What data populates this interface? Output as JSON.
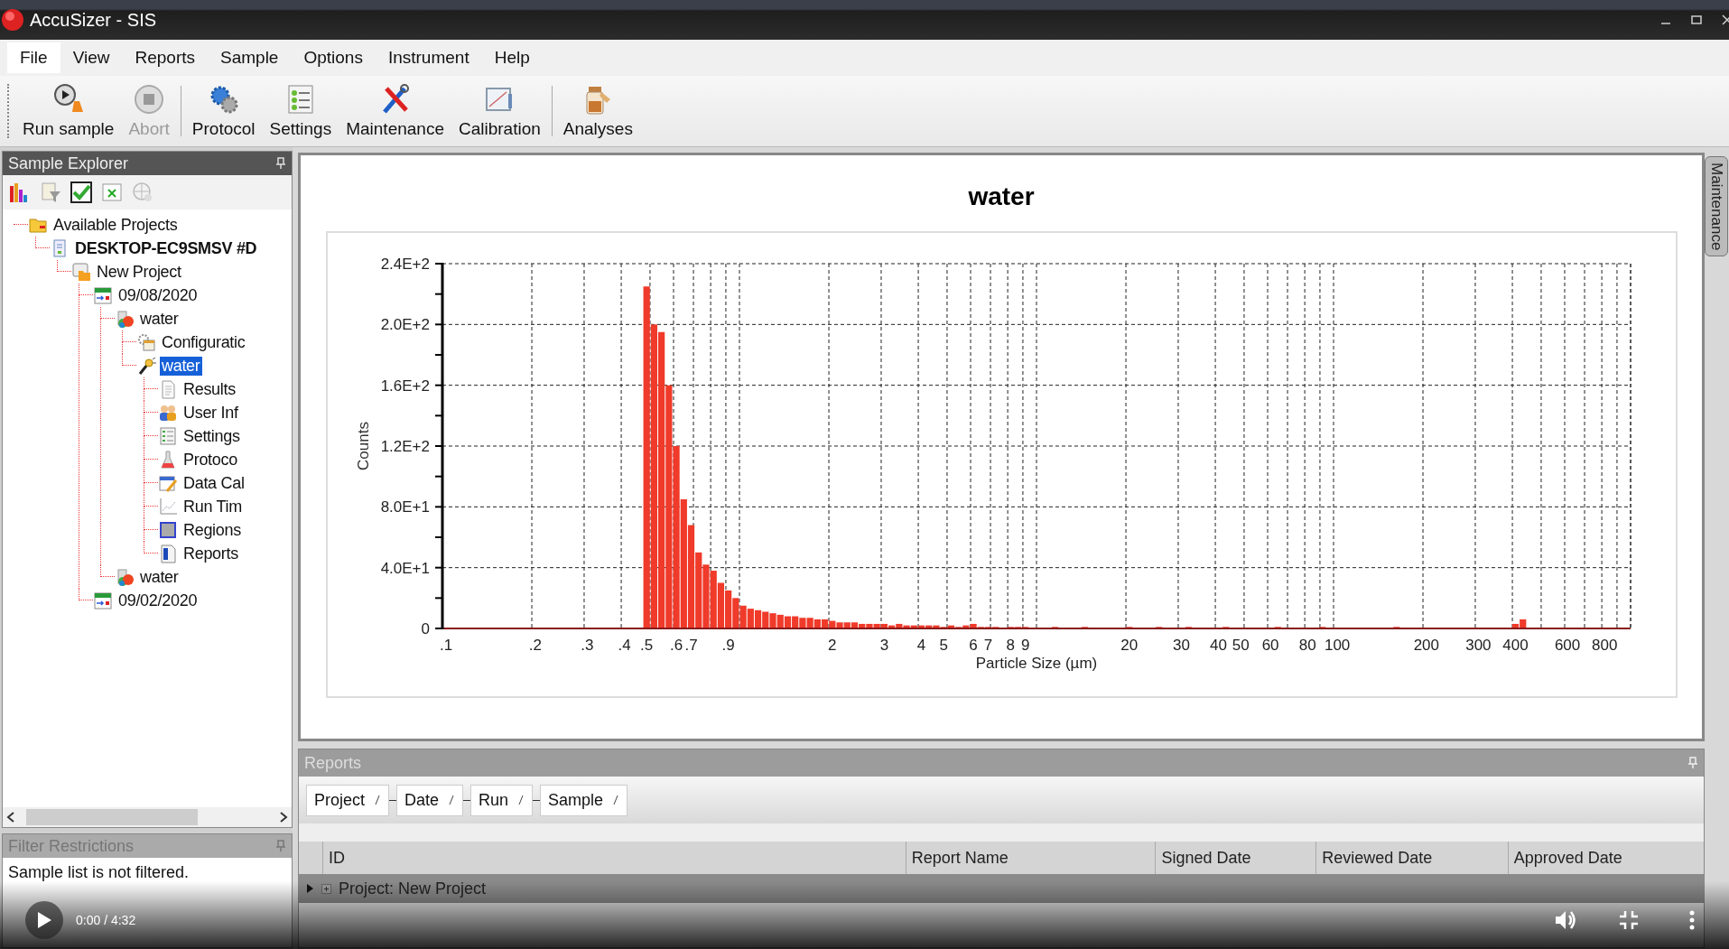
{
  "window": {
    "title": "AccuSizer - SIS"
  },
  "menu": [
    {
      "label": "File",
      "selected": true
    },
    {
      "label": "View",
      "selected": false
    },
    {
      "label": "Reports",
      "selected": false
    },
    {
      "label": "Sample",
      "selected": false
    },
    {
      "label": "Options",
      "selected": false
    },
    {
      "label": "Instrument",
      "selected": false
    },
    {
      "label": "Help",
      "selected": false
    }
  ],
  "toolbar": [
    [
      {
        "label": "Run sample",
        "kind": "run",
        "disabled": false
      },
      {
        "label": "Abort",
        "kind": "abort",
        "disabled": true
      }
    ],
    [
      {
        "label": "Protocol",
        "kind": "protocol",
        "disabled": false
      },
      {
        "label": "Settings",
        "kind": "settings",
        "disabled": false
      },
      {
        "label": "Maintenance",
        "kind": "maintenance",
        "disabled": false
      },
      {
        "label": "Calibration",
        "kind": "calibration",
        "disabled": false
      }
    ],
    [
      {
        "label": "Analyses",
        "kind": "analyses",
        "disabled": false
      }
    ]
  ],
  "sample_explorer": {
    "title": "Sample Explorer",
    "tree": [
      {
        "label": "Available Projects",
        "kind": "folder",
        "bold": false,
        "selected": false,
        "children": [
          {
            "label": "DESKTOP-EC9SMSV #D",
            "kind": "computer",
            "bold": true,
            "selected": false,
            "children": [
              {
                "label": "New Project",
                "kind": "project",
                "bold": false,
                "selected": false,
                "children": [
                  {
                    "label": "09/08/2020",
                    "kind": "date",
                    "bold": false,
                    "selected": false,
                    "children": [
                      {
                        "label": "water",
                        "kind": "sample",
                        "bold": false,
                        "selected": false,
                        "children": [
                          {
                            "label": "Configuratic",
                            "kind": "config",
                            "bold": false,
                            "selected": false
                          },
                          {
                            "label": "water",
                            "kind": "probe",
                            "bold": false,
                            "selected": true,
                            "children": [
                              {
                                "label": "Results",
                                "kind": "document",
                                "bold": false,
                                "selected": false
                              },
                              {
                                "label": "User Inf",
                                "kind": "users",
                                "bold": false,
                                "selected": false
                              },
                              {
                                "label": "Settings",
                                "kind": "settings",
                                "bold": false,
                                "selected": false
                              },
                              {
                                "label": "Protoco",
                                "kind": "flask",
                                "bold": false,
                                "selected": false
                              },
                              {
                                "label": "Data Cal",
                                "kind": "calc",
                                "bold": false,
                                "selected": false
                              },
                              {
                                "label": "Run Tim",
                                "kind": "runtime",
                                "bold": false,
                                "selected": false
                              },
                              {
                                "label": "Regions",
                                "kind": "regions",
                                "bold": false,
                                "selected": false
                              },
                              {
                                "label": "Reports",
                                "kind": "reports",
                                "bold": false,
                                "selected": false
                              }
                            ]
                          }
                        ]
                      },
                      {
                        "label": "water",
                        "kind": "sample",
                        "bold": false,
                        "selected": false
                      }
                    ]
                  },
                  {
                    "label": "09/02/2020",
                    "kind": "date",
                    "bold": false,
                    "selected": false
                  }
                ]
              }
            ]
          }
        ]
      }
    ]
  },
  "filter_restrictions": {
    "title": "Filter Restrictions",
    "text": "Sample list is not filtered."
  },
  "chart_panel": {
    "title": "water",
    "chart_data": {
      "type": "bar",
      "xlabel": "Particle Size (µm)",
      "ylabel": "Counts",
      "categories": [
        ".1",
        null,
        null,
        null,
        null,
        null,
        null,
        null,
        null,
        null,
        null,
        null,
        ".2",
        null,
        null,
        null,
        null,
        null,
        null,
        ".3",
        null,
        null,
        null,
        null,
        ".4",
        null,
        null,
        ".5",
        null,
        null,
        null,
        ".6",
        null,
        ".7",
        null,
        null,
        null,
        null,
        ".9",
        null,
        null,
        null,
        null,
        null,
        null,
        null,
        null,
        null,
        null,
        null,
        null,
        null,
        "2",
        null,
        null,
        null,
        null,
        null,
        null,
        "3",
        null,
        null,
        null,
        null,
        "4",
        null,
        null,
        "5",
        null,
        null,
        null,
        "6",
        null,
        "7",
        null,
        null,
        "8",
        null,
        "9",
        null,
        null,
        null,
        null,
        null,
        null,
        null,
        null,
        null,
        null,
        null,
        null,
        null,
        "20",
        null,
        null,
        null,
        null,
        null,
        null,
        "30",
        null,
        null,
        null,
        null,
        "40",
        null,
        null,
        "50",
        null,
        null,
        null,
        "60",
        null,
        null,
        null,
        null,
        "80",
        null,
        null,
        null,
        "100",
        null,
        null,
        null,
        null,
        null,
        null,
        null,
        null,
        null,
        null,
        null,
        "200",
        null,
        null,
        null,
        null,
        null,
        null,
        "300",
        null,
        null,
        null,
        null,
        "400",
        null,
        null,
        null,
        null,
        null,
        null,
        "600",
        null,
        null,
        null,
        null,
        "800",
        null,
        null,
        null
      ],
      "values": [
        0,
        0,
        0,
        0,
        0,
        0,
        0,
        0,
        0,
        0,
        0,
        0,
        0,
        0,
        0,
        0,
        0,
        0,
        0,
        0,
        0,
        0,
        0,
        0,
        0,
        0,
        0,
        225,
        200,
        195,
        160,
        120,
        85,
        68,
        50,
        42,
        38,
        30,
        25,
        20,
        15,
        13,
        12,
        11,
        10,
        9,
        8,
        8,
        7,
        7,
        6,
        6,
        5,
        4,
        4,
        4,
        3,
        3,
        3,
        3,
        2,
        3,
        2,
        2,
        2,
        2,
        2,
        1,
        2,
        1,
        2,
        3,
        1,
        1,
        1,
        0,
        1,
        1,
        1,
        0,
        0,
        0,
        1,
        0,
        0,
        0,
        1,
        0,
        0,
        0,
        0,
        0,
        1,
        0,
        0,
        0,
        1,
        0,
        0,
        0,
        1,
        0,
        0,
        0,
        0,
        1,
        0,
        0,
        0,
        0,
        0,
        0,
        1,
        0,
        0,
        0,
        0,
        0,
        1,
        0,
        0,
        0,
        0,
        0,
        0,
        0,
        0,
        0,
        1,
        0,
        0,
        0,
        0,
        0,
        0,
        0,
        0,
        0,
        0,
        0,
        0,
        0,
        0,
        0,
        3,
        6,
        0,
        0,
        0,
        0,
        0,
        0,
        0,
        0,
        0,
        0,
        0,
        0,
        0,
        0
      ],
      "ylim": [
        0,
        240
      ],
      "grid": true,
      "yticks": [
        {
          "value": 0,
          "label": "0"
        },
        {
          "value": 40,
          "label": "4.0E+1"
        },
        {
          "value": 80,
          "label": "8.0E+1"
        },
        {
          "value": 120,
          "label": "1.2E+2"
        },
        {
          "value": 160,
          "label": "1.6E+2"
        },
        {
          "value": 200,
          "label": "2.0E+2"
        },
        {
          "value": 240,
          "label": "2.4E+2"
        }
      ]
    }
  },
  "side_tab": {
    "label": "Maintenance"
  },
  "reports": {
    "title": "Reports",
    "group_by": [
      "Project",
      "Date",
      "Run",
      "Sample"
    ],
    "columns": [
      "ID",
      "Report Name",
      "Signed Date",
      "Reviewed Date",
      "Approved Date"
    ],
    "rows": [
      {
        "label": "Project: New Project",
        "expanded": false
      }
    ]
  },
  "video_player": {
    "time": "0:00 / 4:32"
  }
}
